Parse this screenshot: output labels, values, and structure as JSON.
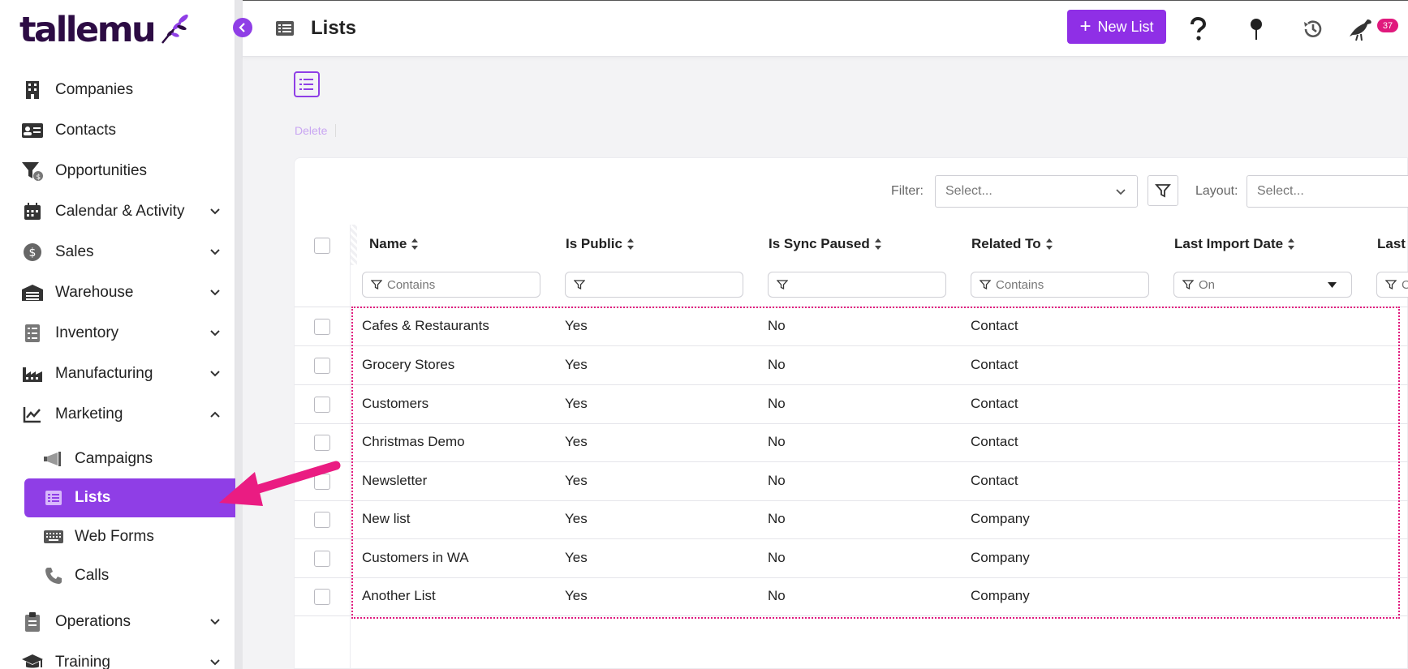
{
  "brand": {
    "logo_text": "tallemu",
    "accent": "#8f3ee6",
    "badge_color": "#e0197d"
  },
  "sidebar": {
    "items": [
      {
        "label": "Companies",
        "icon": "building-icon",
        "expandable": false
      },
      {
        "label": "Contacts",
        "icon": "contact-card-icon",
        "expandable": false
      },
      {
        "label": "Opportunities",
        "icon": "funnel-dollar-icon",
        "expandable": false
      },
      {
        "label": "Calendar & Activity",
        "icon": "calendar-icon",
        "expandable": true
      },
      {
        "label": "Sales",
        "icon": "dollar-circle-icon",
        "expandable": true
      },
      {
        "label": "Warehouse",
        "icon": "warehouse-icon",
        "expandable": true
      },
      {
        "label": "Inventory",
        "icon": "inventory-icon",
        "expandable": true
      },
      {
        "label": "Manufacturing",
        "icon": "factory-icon",
        "expandable": true
      },
      {
        "label": "Marketing",
        "icon": "chart-line-icon",
        "expandable": true,
        "expanded": true
      }
    ],
    "marketing_sub": [
      {
        "label": "Campaigns",
        "icon": "megaphone-icon"
      },
      {
        "label": "Lists",
        "icon": "list-icon",
        "active": true
      },
      {
        "label": "Web Forms",
        "icon": "keyboard-icon"
      },
      {
        "label": "Calls",
        "icon": "phone-icon"
      }
    ],
    "items_after": [
      {
        "label": "Operations",
        "icon": "clipboard-icon",
        "expandable": true
      },
      {
        "label": "Training",
        "icon": "graduation-cap-icon",
        "expandable": true
      }
    ]
  },
  "topbar": {
    "title": "Lists",
    "new_button": "New List",
    "notification_count": "37"
  },
  "toolbar": {
    "delete_label": "Delete"
  },
  "filters": {
    "filter_label": "Filter:",
    "filter_placeholder": "Select...",
    "layout_label": "Layout:",
    "layout_placeholder": "Select..."
  },
  "table": {
    "columns": [
      {
        "label": "Name",
        "filter": "Contains"
      },
      {
        "label": "Is Public",
        "filter": ""
      },
      {
        "label": "Is Sync Paused",
        "filter": ""
      },
      {
        "label": "Related To",
        "filter": "Contains"
      },
      {
        "label": "Last Import Date",
        "filter": "On"
      },
      {
        "label": "Last I",
        "filter": "C"
      }
    ],
    "rows": [
      {
        "name": "Cafes & Restaurants",
        "is_public": "Yes",
        "is_sync_paused": "No",
        "related_to": "Contact"
      },
      {
        "name": "Grocery Stores",
        "is_public": "Yes",
        "is_sync_paused": "No",
        "related_to": "Contact"
      },
      {
        "name": "Customers",
        "is_public": "Yes",
        "is_sync_paused": "No",
        "related_to": "Contact"
      },
      {
        "name": "Christmas Demo",
        "is_public": "Yes",
        "is_sync_paused": "No",
        "related_to": "Contact"
      },
      {
        "name": "Newsletter",
        "is_public": "Yes",
        "is_sync_paused": "No",
        "related_to": "Contact"
      },
      {
        "name": "New list",
        "is_public": "Yes",
        "is_sync_paused": "No",
        "related_to": "Company"
      },
      {
        "name": "Customers in WA",
        "is_public": "Yes",
        "is_sync_paused": "No",
        "related_to": "Company"
      },
      {
        "name": "Another List",
        "is_public": "Yes",
        "is_sync_paused": "No",
        "related_to": "Company"
      }
    ]
  }
}
